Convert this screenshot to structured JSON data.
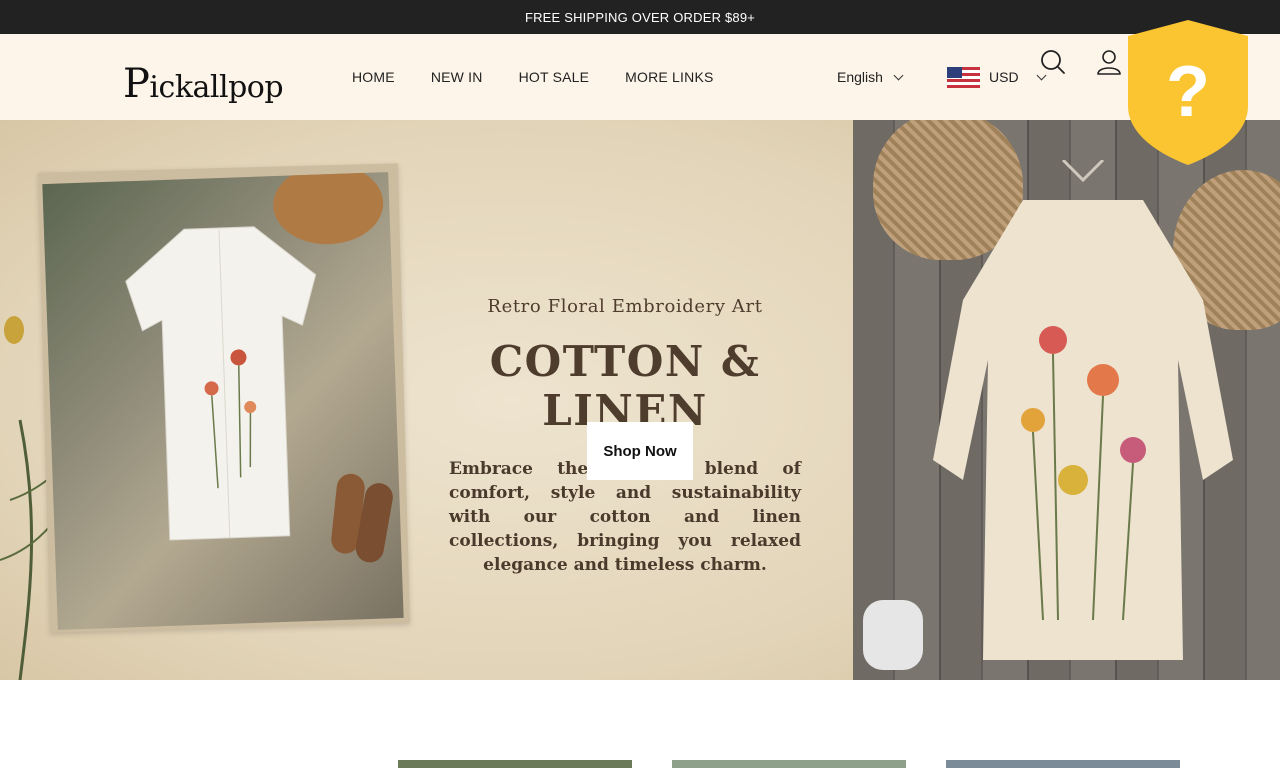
{
  "announcement": "FREE SHIPPING OVER ORDER $89+",
  "logo": {
    "cap": "P",
    "rest": "ickallpop"
  },
  "nav": [
    {
      "label": "HOME",
      "name": "nav-home"
    },
    {
      "label": "NEW IN",
      "name": "nav-new-in"
    },
    {
      "label": "HOT SALE",
      "name": "nav-hot-sale"
    },
    {
      "label": "MORE LINKS",
      "name": "nav-more-links"
    }
  ],
  "language": "English",
  "currency": {
    "code": "USD",
    "flag_icon": "us-flag-icon"
  },
  "icons": {
    "search": "search-icon",
    "account": "user-icon",
    "help": "help-shield-icon"
  },
  "hero": {
    "subtitle": "Retro Floral Embroidery Art",
    "title": "COTTON & LINEN",
    "description": "Embrace the perfect blend of comfort, style and sustainability with our cotton and linen collections, bringing you relaxed elegance and timeless charm.",
    "cta": "Shop Now"
  },
  "colors": {
    "announcement_bg": "#222222",
    "header_bg": "#fdf5ea",
    "hero_text": "#4e3c2c",
    "shield": "#fbc531"
  }
}
